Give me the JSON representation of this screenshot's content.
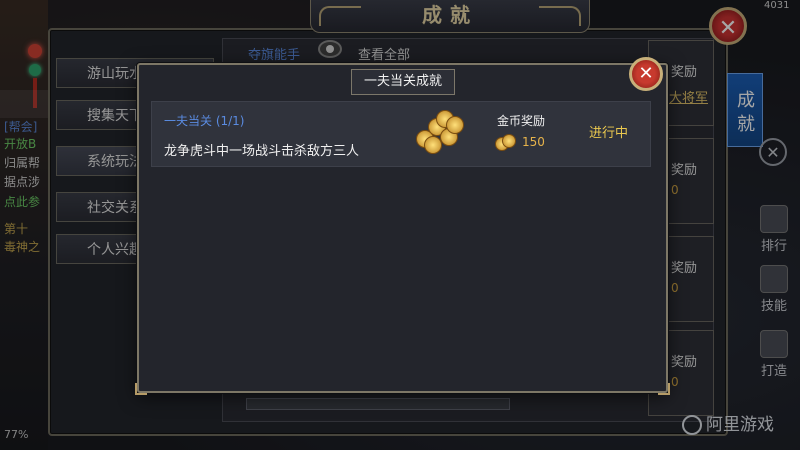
{
  "window": {
    "title": "成就",
    "fps_hint": "4031"
  },
  "scene_left": {
    "lines": [
      "[帮会]",
      "开放B",
      "归属帮",
      "据点涉",
      "点此参",
      "第十",
      "毒神之"
    ],
    "battery": "77%"
  },
  "categories": [
    {
      "label": "游山玩水"
    },
    {
      "label": "搜集天下"
    },
    {
      "label": "系统玩法"
    },
    {
      "label": "社交关系"
    },
    {
      "label": "个人兴趣"
    }
  ],
  "list_header": {
    "hint": "夺旗能手",
    "view_all": "查看全部"
  },
  "reward_cards": [
    {
      "label": "奖励",
      "sub": "大将军"
    },
    {
      "label": "奖励",
      "value": "0"
    },
    {
      "label": "奖励",
      "value": "0"
    },
    {
      "label": "奖励",
      "value": "0"
    }
  ],
  "side": {
    "tab": "成就",
    "buttons": [
      {
        "label": "排行",
        "icon": "rank-icon"
      },
      {
        "label": "技能",
        "icon": "skill-icon"
      },
      {
        "label": "打造",
        "icon": "forge-icon"
      }
    ]
  },
  "watermark": "阿里游戏",
  "modal": {
    "title": "一夫当关成就",
    "item": {
      "name": "一夫当关 (1/1)",
      "description": "龙争虎斗中一场战斗击杀敌方三人",
      "reward_label": "金币奖励",
      "reward_value": "150",
      "status": "进行中"
    }
  },
  "colors": {
    "accent_blue": "#5a8be0",
    "gold": "#e6b34b",
    "status_yellow": "#ebc94f",
    "close_red": "#c73a2e"
  }
}
